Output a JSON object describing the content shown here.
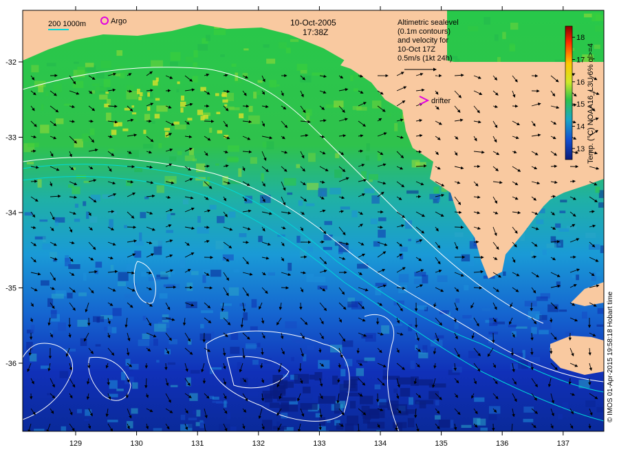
{
  "header": {
    "date": "10-Oct-2005",
    "time": "17:38Z"
  },
  "legend": {
    "isobath_label": "200  1000m",
    "argo_label": "Argo",
    "drifter_label": "drifter",
    "drifter_symbol": ">",
    "info_lines": [
      "Altimetric sealevel",
      "(0.1m contours)",
      "and velocity for",
      "10-Oct 17Z",
      "0.5m/s (1kt 24h)"
    ]
  },
  "colorbar": {
    "ticks": [
      "18",
      "17",
      "16",
      "15",
      "14",
      "13"
    ],
    "title": "Temp. (°C) NOAA16_L3U 6% ql>=4",
    "range": [
      12.5,
      18.5
    ]
  },
  "axes": {
    "x_ticks": [
      "129",
      "130",
      "131",
      "132",
      "133",
      "134",
      "135",
      "136",
      "137"
    ],
    "y_ticks": [
      "-32",
      "-33",
      "-34",
      "-35",
      "-36"
    ]
  },
  "credit": "© IMOS 01-Apr-2015 19:58:18 Hobart time",
  "colors": {
    "land": "#f9c9a0",
    "warm_sst": "#2cc34a",
    "cool_sst": "#1a3fc4",
    "argo": "#e000e0",
    "drifter": "#e000e0",
    "isobath": "#00d0d0",
    "contour": "#ffffff"
  }
}
